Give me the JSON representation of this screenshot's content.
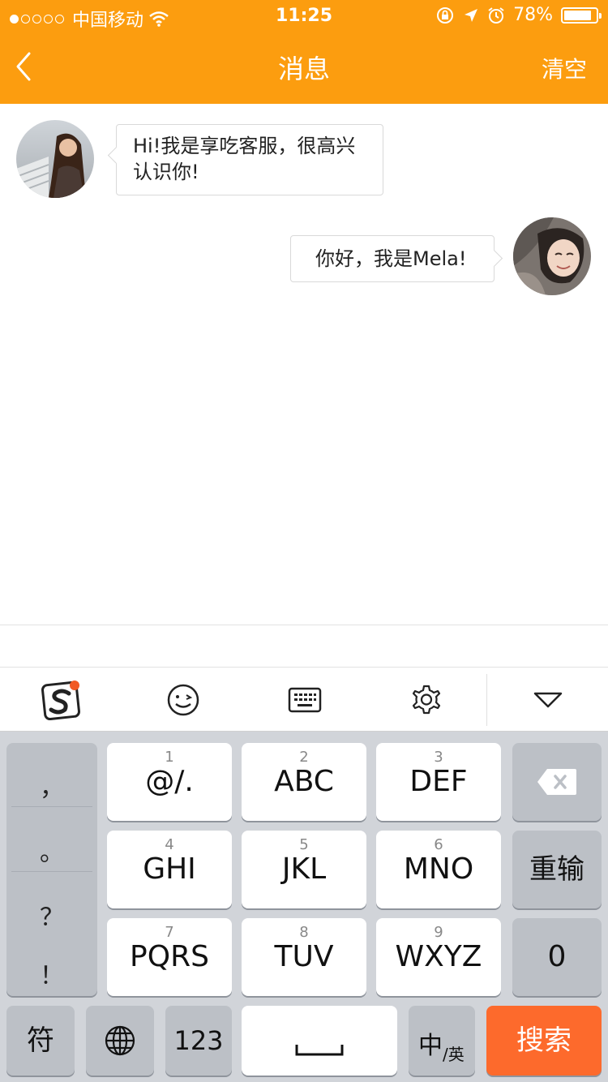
{
  "status_bar": {
    "carrier": "中国移动",
    "time": "11:25",
    "battery": "78%",
    "battery_level": 0.78
  },
  "nav": {
    "title": "消息",
    "right_action": "清空"
  },
  "messages": [
    {
      "side": "left",
      "text_line1": "Hi!我是享吃客服，很高兴",
      "text_line2": "认识你!"
    },
    {
      "side": "right",
      "text": "你好，我是Mela!"
    }
  ],
  "ime_toolbar": {
    "icons": [
      "sogou-logo-icon",
      "emoji-icon",
      "keyboard-icon",
      "settings-icon",
      "collapse-icon"
    ]
  },
  "keyboard": {
    "punctuation": [
      "，",
      "。",
      "？",
      "！"
    ],
    "keys": [
      {
        "num": "1",
        "label": "@/."
      },
      {
        "num": "2",
        "label": "ABC"
      },
      {
        "num": "3",
        "label": "DEF"
      },
      {
        "num": "4",
        "label": "GHI"
      },
      {
        "num": "5",
        "label": "JKL"
      },
      {
        "num": "6",
        "label": "MNO"
      },
      {
        "num": "7",
        "label": "PQRS"
      },
      {
        "num": "8",
        "label": "TUV"
      },
      {
        "num": "9",
        "label": "WXYZ"
      }
    ],
    "reenter": "重输",
    "zero": "0",
    "symbols": "符",
    "numbers": "123",
    "lang_main": "中",
    "lang_sub": "/英",
    "search": "搜索"
  },
  "colors": {
    "header": "#fc9d0f",
    "search_key": "#fd6a2c",
    "sogou_dot": "#f15a24"
  }
}
